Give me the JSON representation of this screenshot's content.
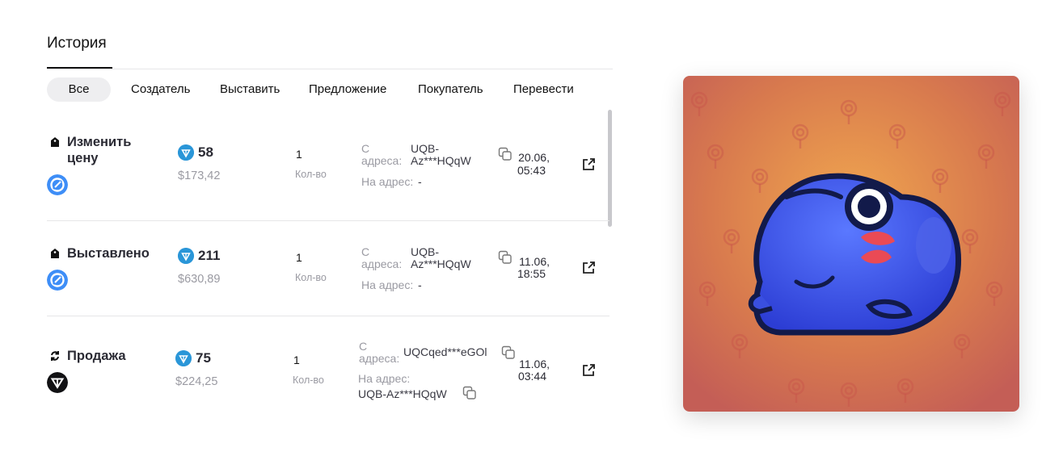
{
  "history": {
    "title": "История",
    "filters": [
      "Все",
      "Создатель",
      "Выставить",
      "Предложение",
      "Покупатель",
      "Перевести"
    ]
  },
  "events": [
    {
      "title_line1": "Изменить",
      "title_line2": "цену",
      "event_icon": "tag-icon",
      "marketplace_icon": "getgems-icon",
      "price": "58",
      "usd": "$173,42",
      "qty": "1",
      "qty_label": "Кол-во",
      "from_label_1": "С",
      "from_label_2": "адреса:",
      "from_addr_1": "UQB-",
      "from_addr_2": "Az***HQqW",
      "to_label": "На адрес:",
      "to_addr": "-",
      "date_1": "20.06,",
      "date_2": "05:43"
    },
    {
      "title_line1": "Выставлено",
      "event_icon": "tag-icon",
      "marketplace_icon": "getgems-icon",
      "price": "211",
      "usd": "$630,89",
      "qty": "1",
      "qty_label": "Кол-во",
      "from_label_1": "С",
      "from_label_2": "адреса:",
      "from_addr_1": "UQB-",
      "from_addr_2": "Az***HQqW",
      "to_label": "На адрес:",
      "to_addr": "-",
      "date_1": "11.06,",
      "date_2": "18:55"
    },
    {
      "title_line1": "Продажа",
      "event_icon": "swap-icon",
      "marketplace_icon": "ton-logo-icon",
      "price": "75",
      "usd": "$224,25",
      "qty": "1",
      "qty_label": "Кол-во",
      "from_label_1": "С",
      "from_label_2": "адреса:",
      "from_addr": "UQCqed***eGOl",
      "to_label": "На адрес:",
      "to_addr": "UQB-Az***HQqW",
      "date_1": "11.06,",
      "date_2": "03:44"
    }
  ],
  "nft_image": {
    "description_icon": "blue-frog-sticker-icon",
    "bg_color": "#d0714f",
    "frog_color": "#3a4fe0"
  }
}
